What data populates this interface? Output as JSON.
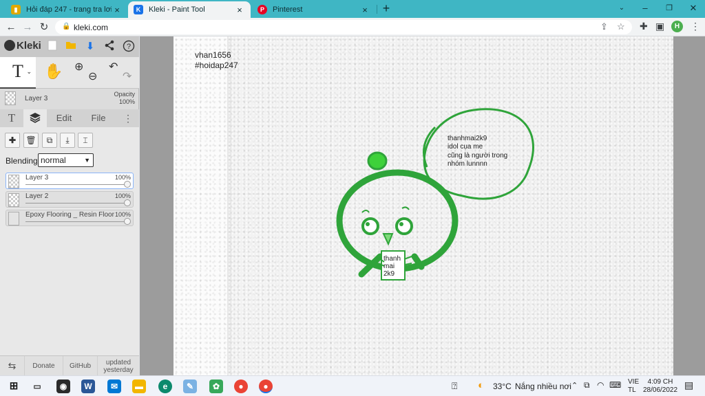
{
  "browser": {
    "tabs": [
      {
        "title": "Hỏi đáp 247 - trang tra lơi",
        "active": false,
        "favicon_color": "#e0a800",
        "favicon": "hoidap-favicon"
      },
      {
        "title": "Kleki - Paint Tool",
        "active": true,
        "favicon_color": "#1a73e8",
        "favicon": "kleki-favicon"
      },
      {
        "title": "Pinterest",
        "active": false,
        "favicon_color": "#e60023",
        "favicon": "pinterest-favicon"
      }
    ],
    "url": "kleki.com",
    "profile_initial": "H"
  },
  "app": {
    "logo": "Kleki",
    "current_layer": "Layer 3",
    "opacity_label": "Opacity",
    "opacity_value": "100%",
    "tabs": [
      {
        "label": "T",
        "kind": "text-tab"
      },
      {
        "label": "",
        "kind": "layers-tab",
        "selected": true
      },
      {
        "label": "Edit",
        "kind": "edit-tab"
      },
      {
        "label": "File",
        "kind": "file-tab"
      }
    ],
    "blending_label": "Blending",
    "blending_value": "normal",
    "layers": [
      {
        "name": "Layer 3",
        "opacity": "100%",
        "selected": true
      },
      {
        "name": "Layer 2",
        "opacity": "100%",
        "selected": false
      },
      {
        "name": "Epoxy Flooring _ Resin Floor",
        "opacity": "100%",
        "selected": false
      }
    ],
    "footer": {
      "donate": "Donate",
      "github": "GitHub",
      "updated": "updated yesterday"
    }
  },
  "canvas": {
    "watermark_line1": "vhan1656",
    "watermark_line2": "#hoidap247",
    "speech_lines": [
      "thanhmai2k9",
      "idol cụa me",
      "cũng là người trong",
      "nhóm lunnnn"
    ],
    "sign_lines": [
      "thanh",
      "mai",
      "2k9"
    ],
    "stroke_color": "#2fa43a",
    "leaf_color": "#3ed13a"
  },
  "taskbar": {
    "temperature": "33°C",
    "weather": "Nắng nhiều nơi",
    "lang_line1": "VIE",
    "lang_line2": "TL",
    "time": "4:09 CH",
    "date": "28/06/2022"
  }
}
